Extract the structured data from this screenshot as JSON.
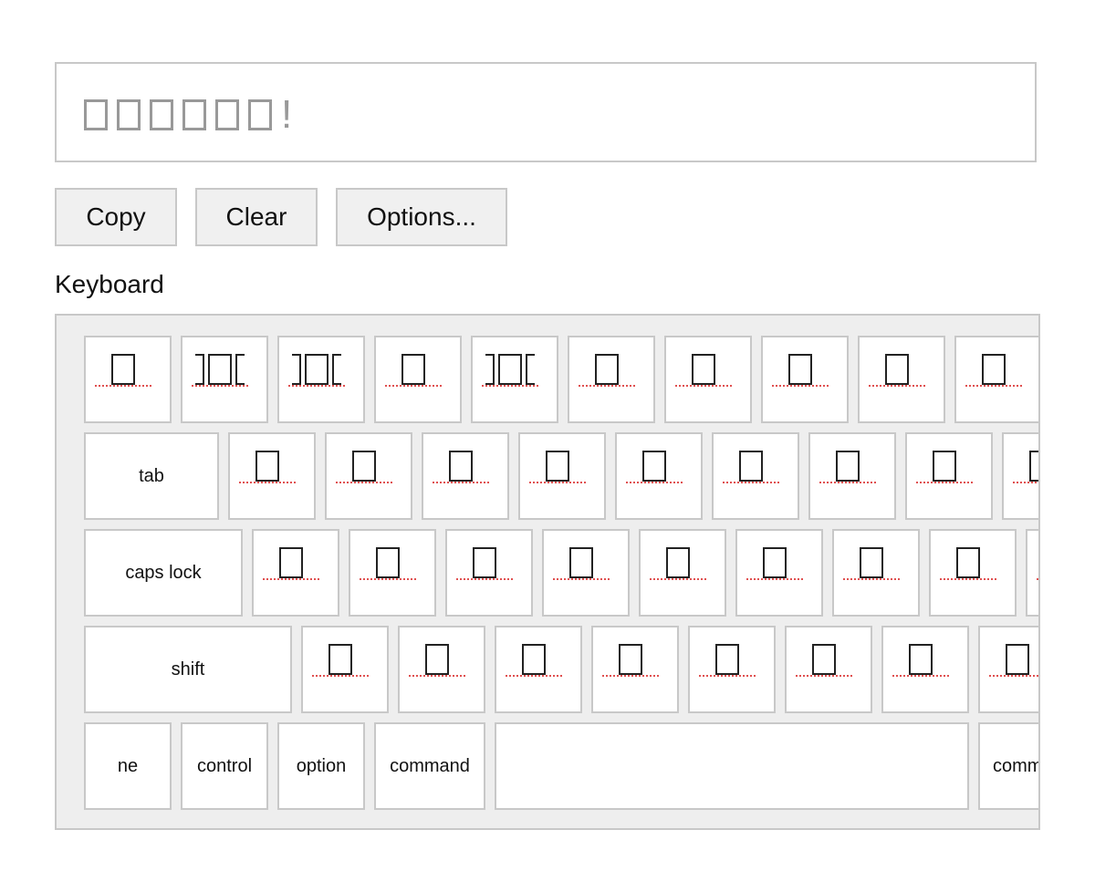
{
  "output": {
    "text_tofu_count": 6,
    "text_suffix": "!"
  },
  "buttons": {
    "copy": "Copy",
    "clear": "Clear",
    "options": "Options..."
  },
  "keyboard": {
    "label": "Keyboard",
    "modifiers": {
      "tab": "tab",
      "caps_lock": "caps lock",
      "shift": "shift",
      "ne": "ne",
      "control": "control",
      "option": "option",
      "command_left": "command",
      "command_right": "comm"
    }
  },
  "colors": {
    "border": "#c8c8c8",
    "button_bg": "#f0f0f0",
    "keyboard_bg": "#eeeeee",
    "output_text": "#999999",
    "glyph_underline": "#e05050"
  }
}
